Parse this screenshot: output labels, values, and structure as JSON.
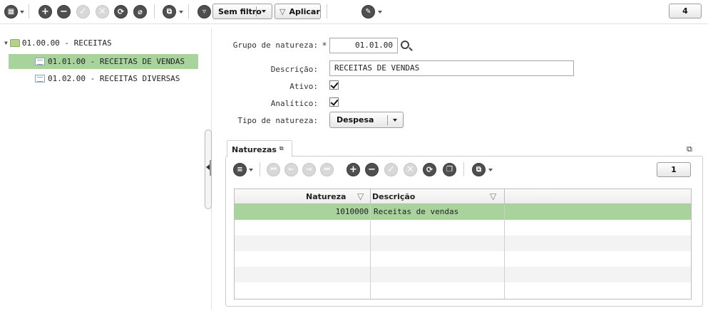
{
  "toolbar": {
    "filter_select_label": "Sem filtro",
    "apply_label": "Aplicar",
    "record_count": "4"
  },
  "tree": {
    "root_label": "01.00.00 - RECEITAS",
    "children": [
      {
        "label": "01.01.00 - RECEITAS DE VENDAS",
        "selected": true
      },
      {
        "label": "01.02.00 - RECEITAS DIVERSAS",
        "selected": false
      }
    ]
  },
  "form": {
    "grupo_label": "Grupo de natureza:",
    "grupo_required_mark": "*",
    "grupo_value": "01.01.00",
    "descricao_label": "Descrição:",
    "descricao_value": "RECEITAS DE VENDAS",
    "ativo_label": "Ativo:",
    "ativo_checked": true,
    "analitico_label": "Analítico:",
    "analitico_checked": true,
    "tipo_label": "Tipo de natureza:",
    "tipo_value": "Despesa"
  },
  "subpanel": {
    "tab_label": "Naturezas",
    "record_count": "1",
    "columns": [
      "Natureza",
      "Descrição"
    ],
    "rows": [
      {
        "natureza": "1010000",
        "descricao": "Receitas de vendas"
      }
    ]
  },
  "colors": {
    "selection_green": "#a9d39d",
    "icon_dark": "#4f4f4f",
    "icon_disabled": "#d8d8d8"
  }
}
